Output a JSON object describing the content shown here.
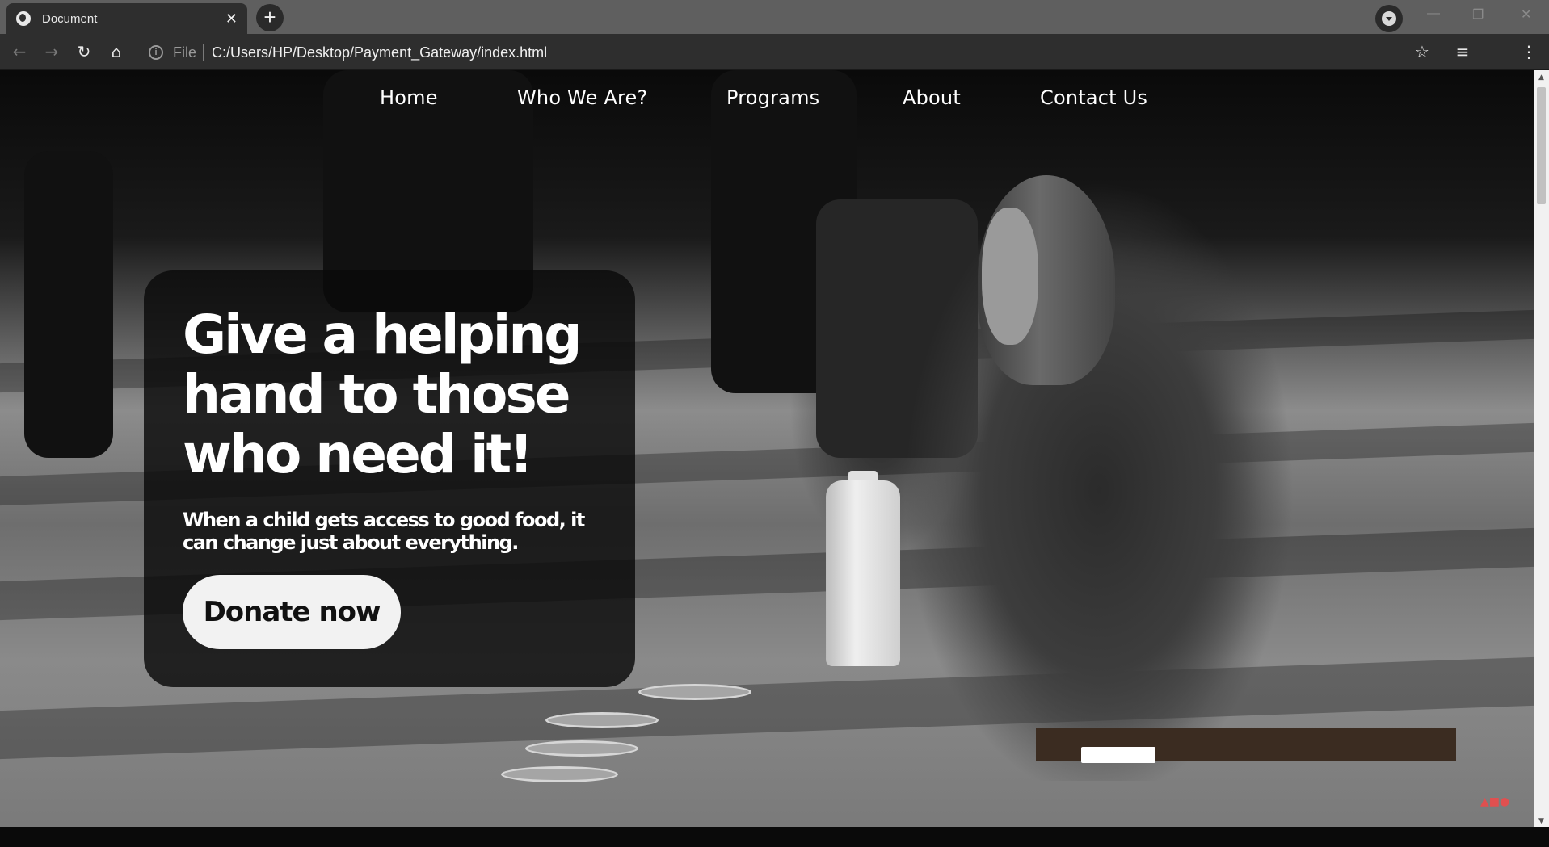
{
  "browser": {
    "tab_title": "Document",
    "tab_close": "✕",
    "new_tab": "+",
    "url_scheme": "File",
    "url": "C:/Users/HP/Desktop/Payment_Gateway/index.html",
    "info_icon": "i"
  },
  "nav": {
    "items": [
      {
        "label": "Home"
      },
      {
        "label": "Who We Are?"
      },
      {
        "label": "Programs"
      },
      {
        "label": "About"
      },
      {
        "label": "Contact Us"
      }
    ]
  },
  "hero": {
    "title": "Give a helping hand to those who need it!",
    "subtitle": "When a child gets access to good food, it can change just about everything.",
    "cta_label": "Donate now"
  },
  "icons": {
    "back": "back-arrow-icon",
    "forward": "forward-arrow-icon",
    "reload": "reload-icon",
    "home": "home-icon",
    "bookmark": "star-icon",
    "media": "media-queue-icon",
    "menu": "kebab-menu-icon"
  },
  "colors": {
    "card_bg": "#0a0a0a",
    "button_bg": "#f2f2f2",
    "nav_text": "#ffffff"
  }
}
